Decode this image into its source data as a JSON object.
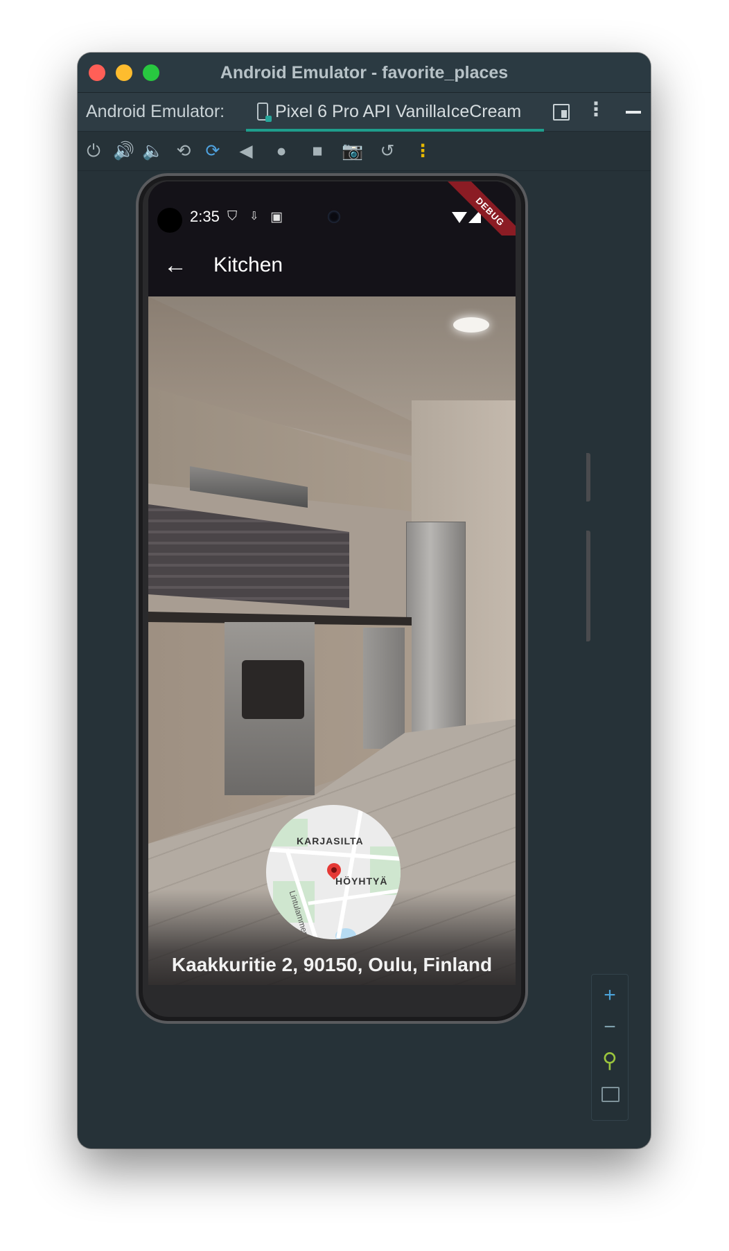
{
  "window": {
    "title": "Android Emulator - favorite_places"
  },
  "tabbar": {
    "label": "Android Emulator:",
    "device_tab": "Pixel 6 Pro API VanillaIceCream"
  },
  "toolbar": {
    "icons": [
      "power-icon",
      "volume-up-icon",
      "volume-down-icon",
      "rotate-left-icon",
      "rotate-right-icon",
      "back-icon",
      "home-icon",
      "overview-icon",
      "screenshot-icon",
      "snapshot-icon",
      "more-icon"
    ]
  },
  "status_bar": {
    "time": "2:35",
    "debug_banner": "DEBUG"
  },
  "app_bar": {
    "title": "Kitchen"
  },
  "map": {
    "label_district": "KARJASILTA",
    "label_area": "HÖYHTYÄ",
    "street": "Lintulammen"
  },
  "place": {
    "address": "Kaakkuritie 2, 90150, Oulu, Finland"
  },
  "zoom_panel": {
    "plus": "+",
    "minus": "−"
  },
  "colors": {
    "accent_teal": "#1e9e8c",
    "debug_red": "#8b1c24",
    "pin_red": "#e53935"
  }
}
